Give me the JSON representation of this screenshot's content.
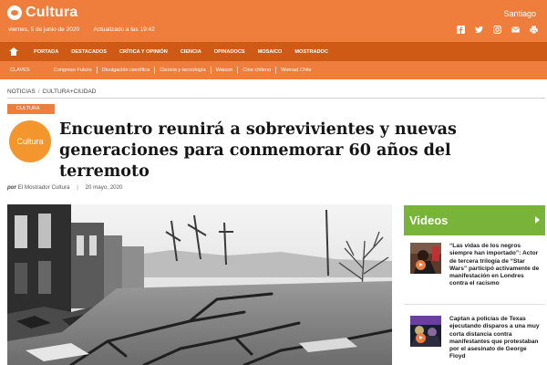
{
  "header": {
    "brand": "Cultura",
    "date": "viernes, 5 de junio de 2020",
    "updated": "Actualizado a las 19:42",
    "city": "Santiago",
    "social_icons": [
      "facebook-icon",
      "twitter-icon",
      "instagram-icon",
      "email-icon",
      "print-icon"
    ]
  },
  "main_nav": [
    "PORTADA",
    "DESTACADOS",
    "CRÍTICA Y OPINIÓN",
    "CIENCIA",
    "OPINADOCS",
    "MOSAICO",
    "MOSTRADOC"
  ],
  "sub_nav": {
    "label": "CLAVES",
    "items": [
      "Congreso Futuro",
      "Divulgación científica",
      "Ciencia y tecnología",
      "Watson",
      "Cine chileno",
      "Womad Chile"
    ]
  },
  "breadcrumb": [
    "NOTICIAS",
    "CULTURA+CIUDAD"
  ],
  "article": {
    "section": "CULTURA",
    "badge": "Cultura",
    "title": "Encuentro reunirá a sobrevivientes y nuevas generaciones para conmemorar 60 años del terremoto",
    "by": "por",
    "author": "El Mostrador Cultura",
    "date": "20 mayo, 2020"
  },
  "sidebar": {
    "title": "Videos",
    "items": [
      {
        "text": "“Las vidas de los negros siempre han importado”: Actor de tercera trilogía de “Star Wars” participó activamente de manifestación en Londres contra el racismo"
      },
      {
        "text": "Captan a policías de Texas ejecutando disparos a una muy corta distancia contra manifestantes que protestaban por el asesinato de George Floyd"
      }
    ]
  },
  "colors": {
    "brand_orange": "#ef7d3c",
    "nav_dark_orange": "#ce5a16",
    "videos_green": "#79b43a"
  }
}
